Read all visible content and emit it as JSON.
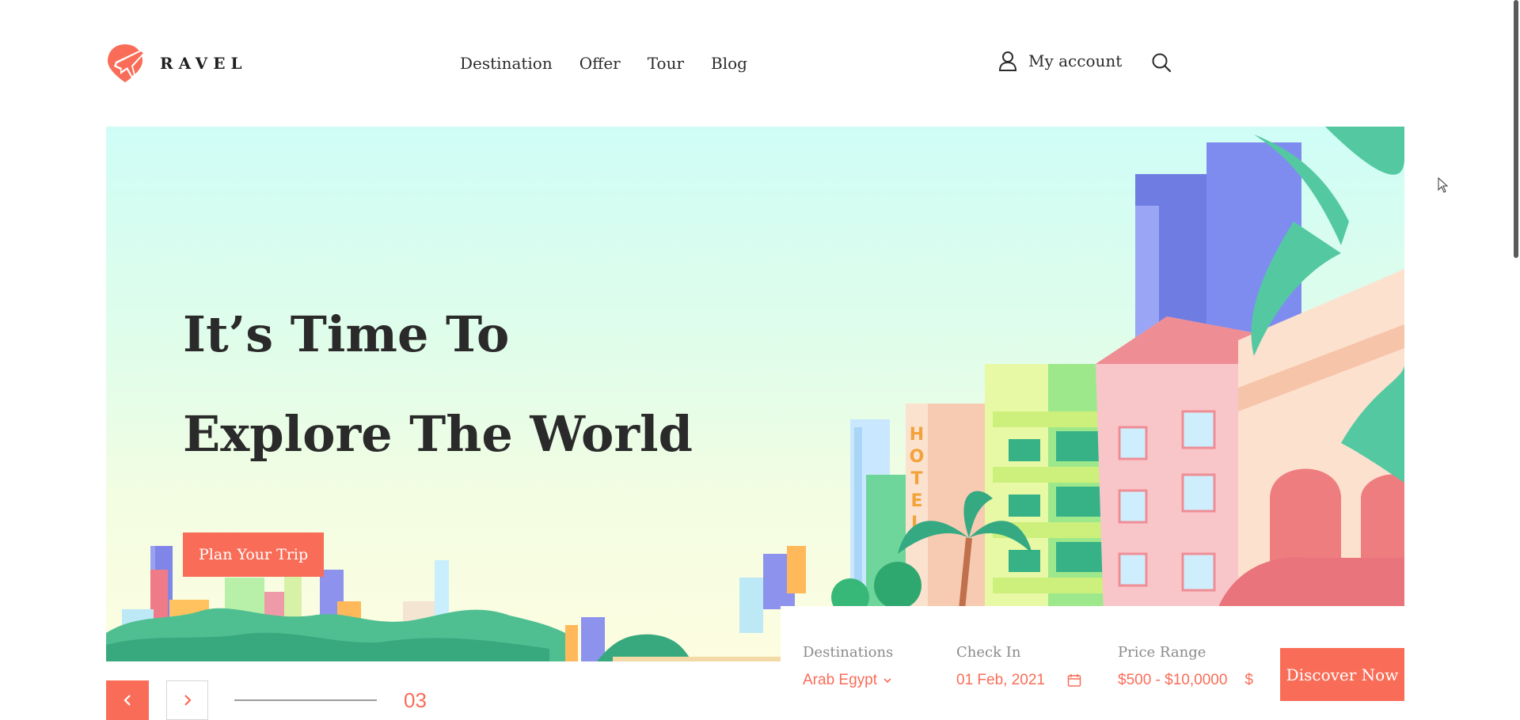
{
  "brand": {
    "name": "RAVEL",
    "accent": "#f96d58"
  },
  "nav": [
    {
      "label": "Destination"
    },
    {
      "label": "Offer"
    },
    {
      "label": "Tour"
    },
    {
      "label": "Blog"
    }
  ],
  "account": {
    "label": "My account",
    "icon": "user-icon"
  },
  "search": {
    "icon": "search-icon"
  },
  "hero": {
    "title_line1": "It’s Time To",
    "title_line2": "Explore The World",
    "cta_label": "Plan Your Trip",
    "building_sign": "HOTEL"
  },
  "booking": {
    "destinations": {
      "label": "Destinations",
      "value": "Arab Egypt"
    },
    "check_in": {
      "label": "Check In",
      "value": "01 Feb, 2021"
    },
    "price_range": {
      "label": "Price Range",
      "value": "$500 - $10,0000",
      "currency": "$"
    },
    "submit_label": "Discover Now"
  },
  "slider": {
    "current": "03",
    "progress": 1.0
  }
}
